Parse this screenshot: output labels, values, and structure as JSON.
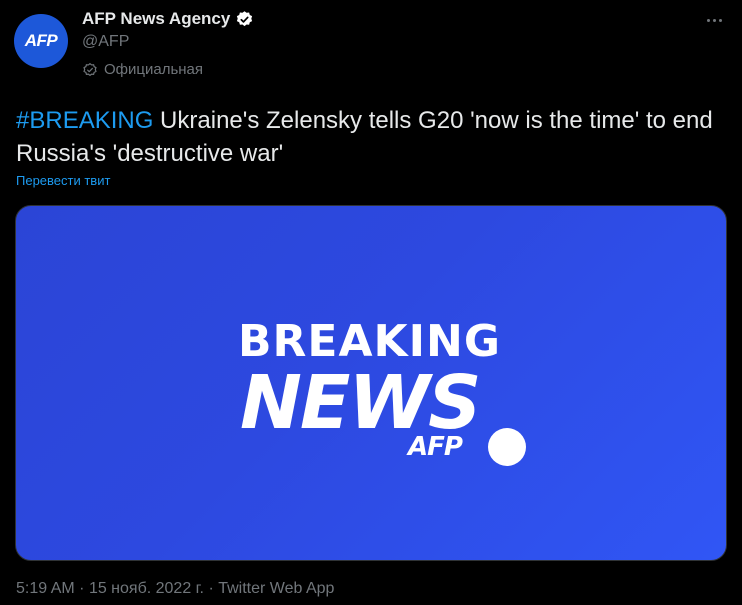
{
  "author": {
    "avatar_text": "AFP",
    "display_name": "AFP News Agency",
    "handle": "@AFP",
    "official_label": "Официальная",
    "avatar_color": "#1d58d9",
    "verified_icon": "verified-badge-icon",
    "official_icon": "official-check-icon"
  },
  "tweet": {
    "hashtag": "#BREAKING",
    "text": " Ukraine's Zelensky tells G20 'now is the time' to end Russia's 'destructive war'",
    "translate_label": "Перевести твит",
    "link_color": "#1d9bf0"
  },
  "media": {
    "line1": "BREAKING",
    "line2": "NEWS",
    "brand": "AFP",
    "background_color": "#2d49e0"
  },
  "meta": {
    "time": "5:19 AM",
    "separator": "·",
    "date": "15 нояб. 2022 г.",
    "app": "Twitter Web App"
  }
}
